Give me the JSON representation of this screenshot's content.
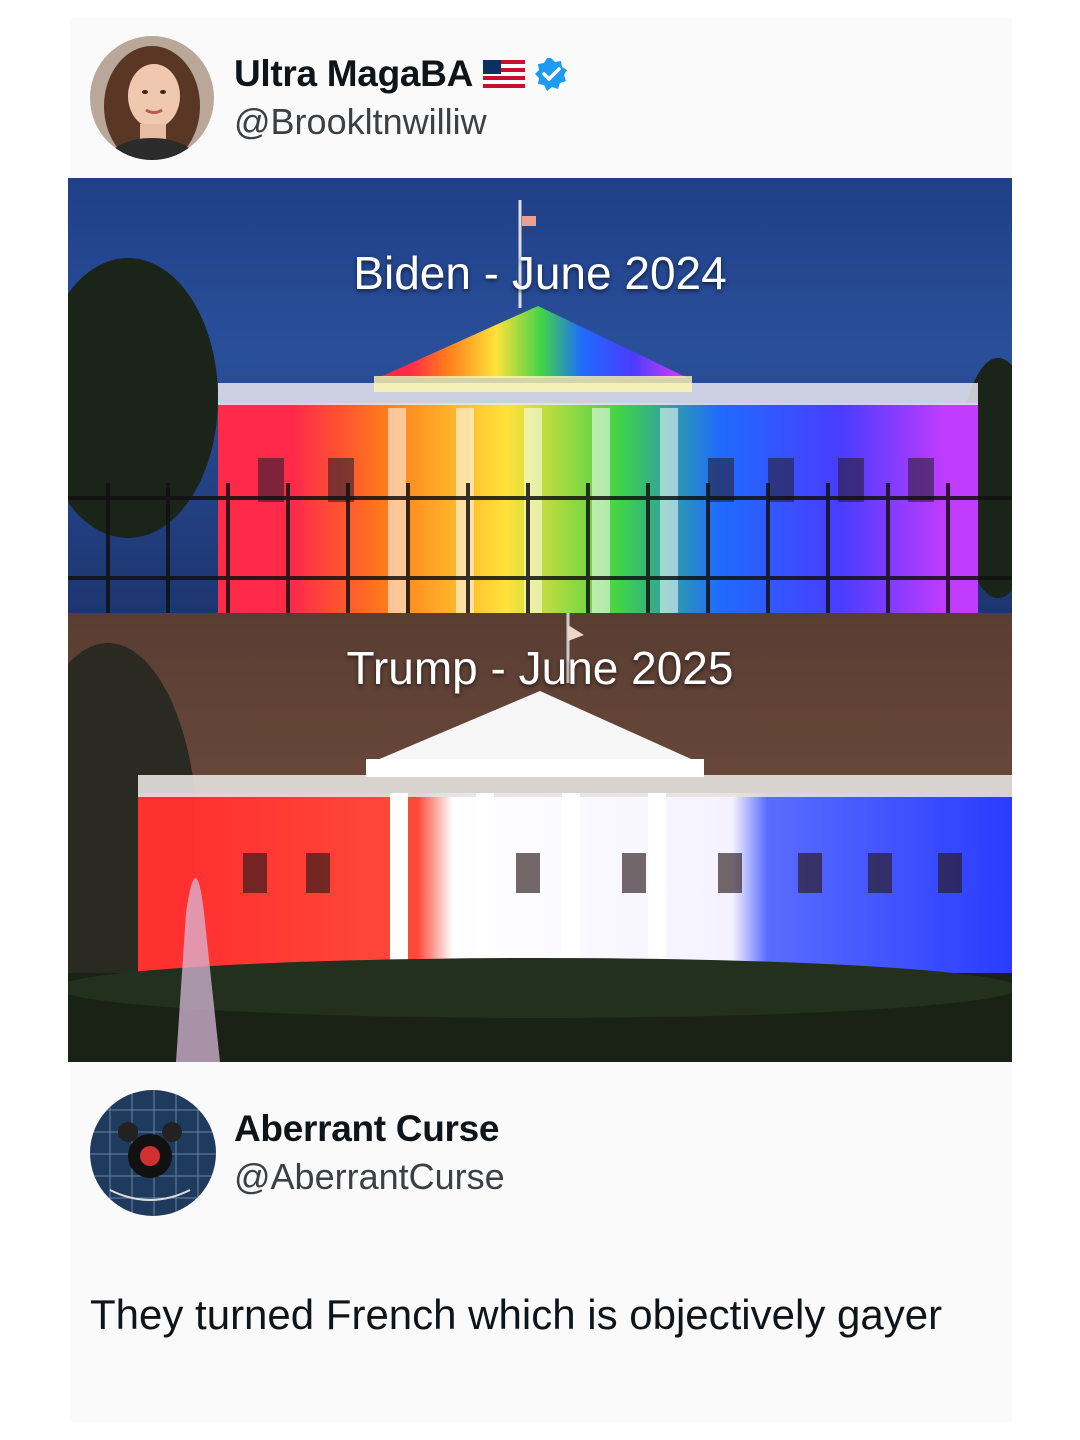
{
  "original_tweet": {
    "name": "Ultra MagaBA",
    "handle": "@Brookltnwilliw",
    "icons": [
      "us-flag-icon",
      "verified-badge-icon"
    ],
    "image": {
      "top_caption": "Biden - June 2024",
      "bottom_caption": "Trump - June 2025"
    }
  },
  "reply_tweet": {
    "name": "Aberrant Curse",
    "handle": "@AberrantCurse",
    "text": "They turned French which is objectively gayer"
  },
  "colors": {
    "verified": "#1d9bf0",
    "text": "#0f1419",
    "handle": "#3c4043"
  }
}
